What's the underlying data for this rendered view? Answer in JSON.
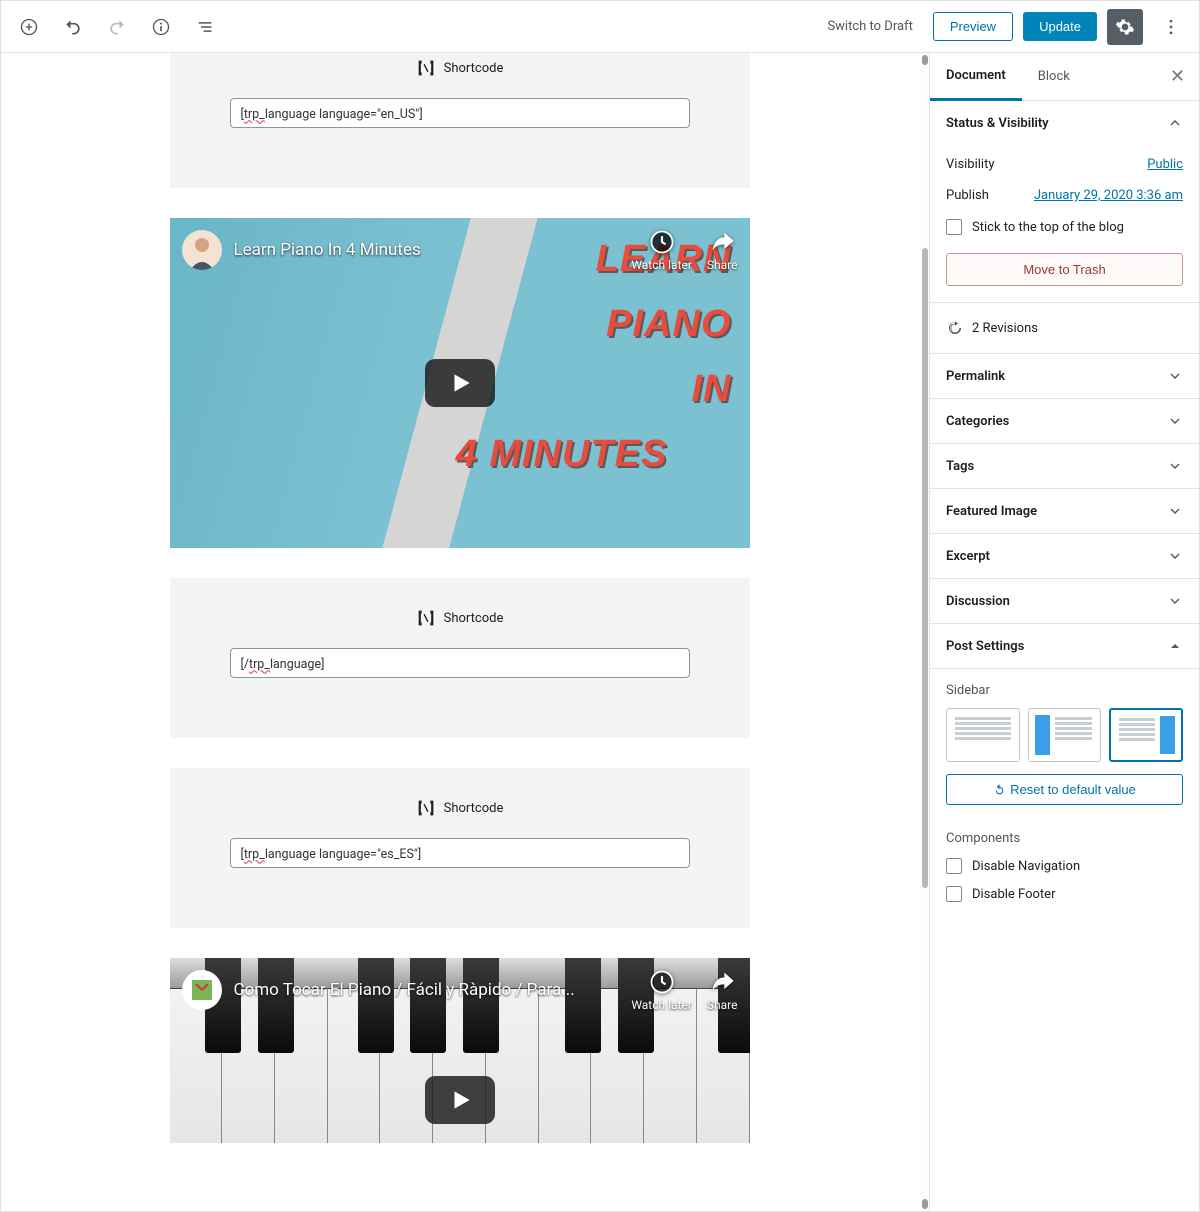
{
  "toolbar": {
    "switch_draft": "Switch to Draft",
    "preview": "Preview",
    "update": "Update"
  },
  "sidebar": {
    "tab_document": "Document",
    "tab_block": "Block",
    "status": {
      "title": "Status & Visibility",
      "visibility_label": "Visibility",
      "visibility_value": "Public",
      "publish_label": "Publish",
      "publish_value": "January 29, 2020 3:36 am",
      "stick_label": "Stick to the top of the blog",
      "trash": "Move to Trash"
    },
    "revisions": "2 Revisions",
    "panels": {
      "permalink": "Permalink",
      "categories": "Categories",
      "tags": "Tags",
      "featured": "Featured Image",
      "excerpt": "Excerpt",
      "discussion": "Discussion",
      "post_settings": "Post Settings"
    },
    "sidebar_section": {
      "heading": "Sidebar",
      "reset": "Reset to default value"
    },
    "components": {
      "heading": "Components",
      "disable_nav": "Disable Navigation",
      "disable_footer": "Disable Footer"
    }
  },
  "blocks": {
    "shortcode_label": "Shortcode",
    "sc1_prefix": "[",
    "sc1_wavy": "trp_",
    "sc1_rest": "language language=\"en_US\"]",
    "sc2_prefix": "[/",
    "sc2_wavy": "trp_",
    "sc2_rest": "language]",
    "sc3_prefix": "[",
    "sc3_wavy": "trp_",
    "sc3_rest": "language language=\"es_ES\"]"
  },
  "video1": {
    "title": "Learn Piano In 4 Minutes",
    "watch_later": "Watch later",
    "share": "Share",
    "thumb_l1": "LEARN",
    "thumb_l2": "PIANO",
    "thumb_l3": "IN",
    "thumb_l4": "4 MINUTES"
  },
  "video2": {
    "title": "Como Tocar El Piano / Fácil y Ràpido / Para...",
    "watch_later": "Watch later",
    "share": "Share"
  }
}
